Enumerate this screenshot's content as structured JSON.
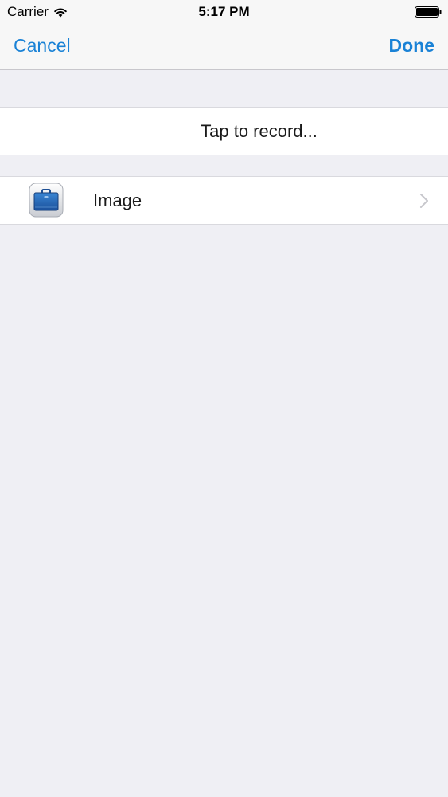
{
  "status_bar": {
    "carrier": "Carrier",
    "time": "5:17 PM"
  },
  "nav_bar": {
    "cancel_label": "Cancel",
    "done_label": "Done"
  },
  "record_section": {
    "label": "Tap to record..."
  },
  "attachment_section": {
    "items": [
      {
        "label": "Image",
        "icon": "briefcase-icon"
      }
    ]
  },
  "colors": {
    "accent": "#1a82d6",
    "background": "#efeff4",
    "bar_background": "#f7f7f7"
  }
}
